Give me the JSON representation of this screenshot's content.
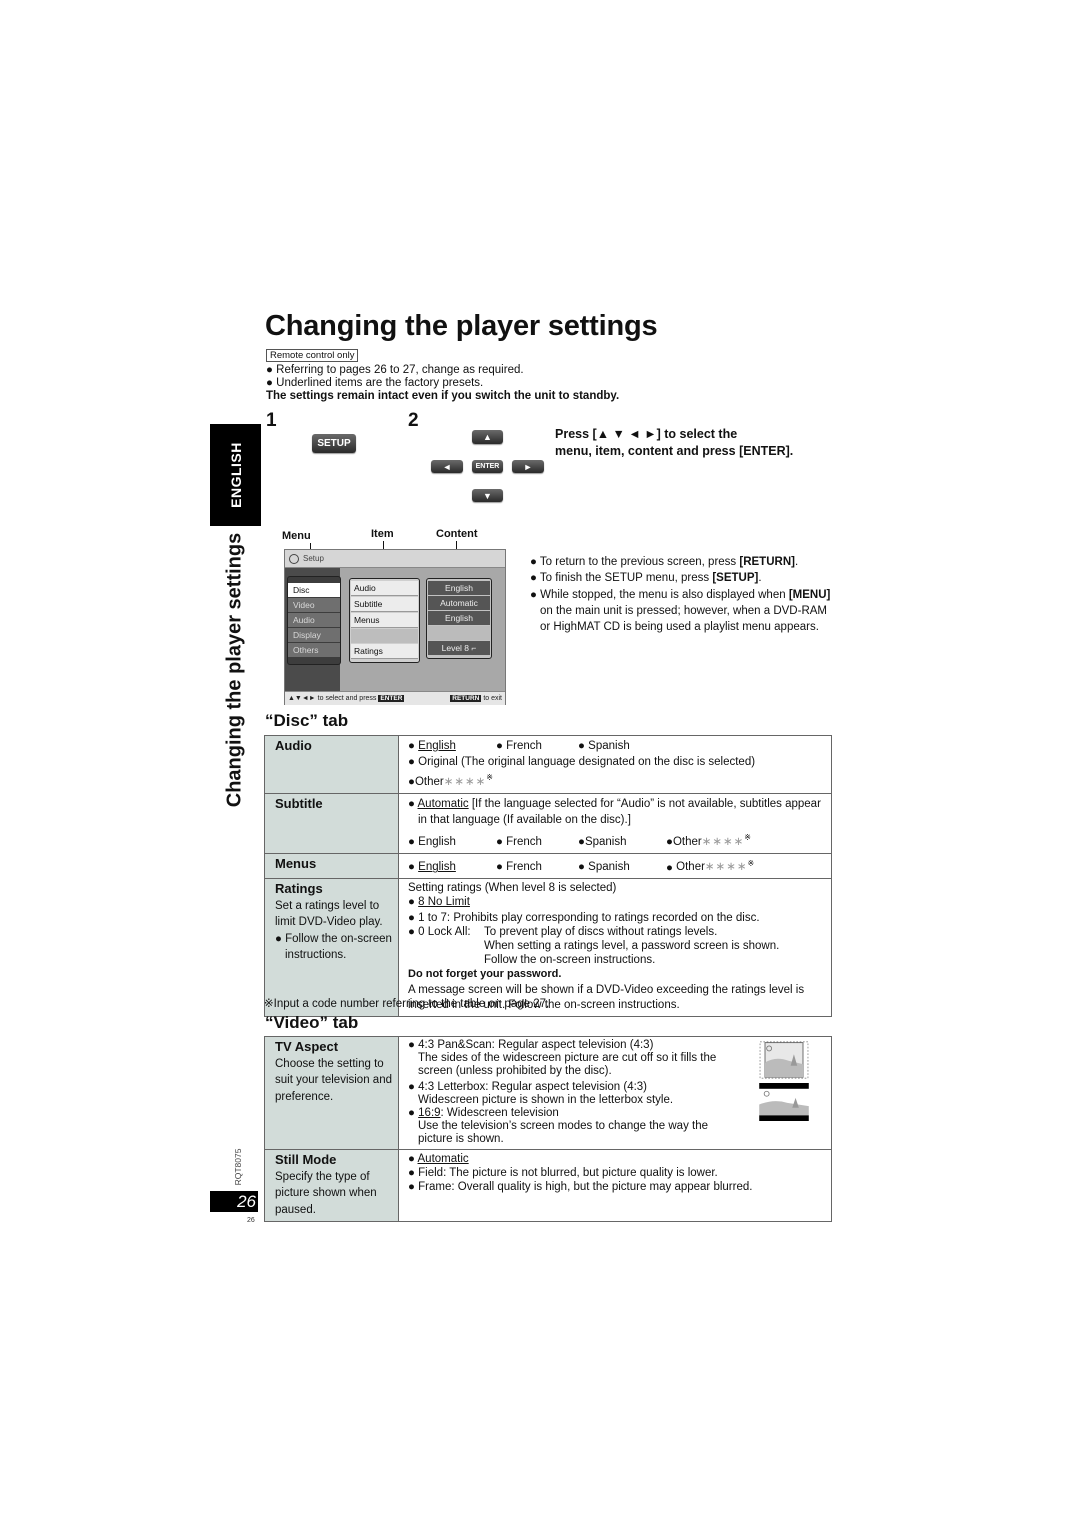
{
  "header": {
    "title": "Changing the player settings",
    "remote_badge": "Remote control only",
    "intro_bullets": [
      "● Referring to pages 26 to 27, change as required.",
      "● Underlined items are the factory presets."
    ],
    "intro_bold": "The settings remain intact even if you switch the unit to standby."
  },
  "side": {
    "language_tab": "ENGLISH",
    "section_title": "Changing the player settings",
    "model_code": "RQT8075",
    "page_number": "26",
    "page_number_small": "26"
  },
  "steps": {
    "step1": {
      "number": "1",
      "button": "SETUP"
    },
    "step2": {
      "number": "2",
      "buttons": {
        "up": "▲",
        "down": "▼",
        "left": "◄",
        "right": "►",
        "enter": "ENTER"
      },
      "instruction_line1": "Press [▲ ▼ ◄ ►] to select the",
      "instruction_line2": "menu, item, content and press [ENTER]."
    }
  },
  "osd": {
    "labels": {
      "menu": "Menu",
      "item": "Item",
      "content": "Content"
    },
    "header": "Setup",
    "menu_items": [
      "Disc",
      "Video",
      "Audio",
      "Display",
      "Others"
    ],
    "selected_menu": "Disc",
    "items": [
      "Audio",
      "Subtitle",
      "Menus",
      "",
      "Ratings"
    ],
    "contents": [
      "English",
      "Automatic",
      "English",
      "",
      "Level 8 ⌐"
    ],
    "footer_left": "▲▼◄► to select and press",
    "footer_enter": "ENTER",
    "footer_return": "RETURN",
    "footer_exit": "to exit"
  },
  "notes": [
    {
      "pre": "● To return to the previous screen, press ",
      "bold": "[RETURN]",
      "post": "."
    },
    {
      "pre": "● To finish the SETUP menu, press ",
      "bold": "[SETUP]",
      "post": "."
    },
    {
      "pre": "● While stopped, the menu is also displayed when ",
      "bold": "[MENU]",
      "post": " on the main unit is pressed; however, when a DVD-RAM or HighMAT CD is being used a playlist menu appears."
    }
  ],
  "disc_tab": {
    "heading": "“Disc” tab",
    "audio": {
      "label": "Audio",
      "opt_english": "English",
      "opt_french": "French",
      "opt_spanish": "Spanish",
      "original": "Original (The original language designated on the disc is selected)",
      "other": "Other",
      "stars": "∗∗∗∗",
      "ref": "※"
    },
    "subtitle": {
      "label": "Subtitle",
      "automatic": "Automatic",
      "automatic_desc": " [If the language selected for “Audio” is not available, subtitles appear in that language (If available on the disc).]",
      "opt_english": "English",
      "opt_french": "French",
      "opt_spanish": "Spanish",
      "other": "Other",
      "stars": "∗∗∗∗",
      "ref": "※"
    },
    "menus": {
      "label": "Menus",
      "opt_english": "English",
      "opt_french": "French",
      "opt_spanish": "Spanish",
      "other": "Other",
      "stars": "∗∗∗∗",
      "ref": "※"
    },
    "ratings": {
      "label": "Ratings",
      "desc1": "Set a ratings level to limit DVD-Video play.",
      "desc2": "● Follow the on-screen instructions.",
      "intro": "Setting ratings (When level 8 is selected)",
      "no_limit": "8 No Limit",
      "one_to_seven": "1 to 7: Prohibits play corresponding to ratings recorded on the disc.",
      "lock_all_label": "0 Lock All:",
      "lock_all_1": "To prevent play of discs without ratings levels.",
      "lock_all_2": "When setting a ratings level, a password screen is shown.",
      "lock_all_3": "Follow the on-screen instructions.",
      "warning": "Do not forget your password.",
      "message": "A message screen will be shown if a DVD-Video exceeding the ratings level is inserted in the unit. Follow the on-screen instructions."
    },
    "footnote": "※Input a code number referring to the table on page 27."
  },
  "video_tab": {
    "heading": "“Video” tab",
    "tv_aspect": {
      "label": "TV Aspect",
      "desc": "Choose the setting to suit your television and preference.",
      "pan_scan_title": "4:3 Pan&Scan: Regular aspect television (4:3)",
      "pan_scan_desc": "The sides of the widescreen picture are cut off so it fills the screen (unless prohibited by the disc).",
      "letterbox_title": "4:3 Letterbox: Regular aspect television (4:3)",
      "letterbox_desc": "Widescreen picture is shown in the letterbox style.",
      "wide_key": "16:9",
      "wide_title": ": Widescreen television",
      "wide_desc": "Use the television’s screen modes to change the way the picture is shown."
    },
    "still_mode": {
      "label": "Still Mode",
      "desc": "Specify the type of picture shown when paused.",
      "automatic": "Automatic",
      "field": "Field: The picture is not blurred, but picture quality is lower.",
      "frame": "Frame: Overall quality is high, but the picture may appear blurred."
    }
  }
}
